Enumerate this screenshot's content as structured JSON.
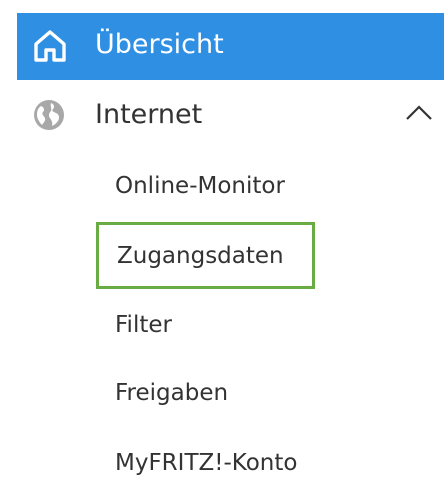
{
  "nav": {
    "home": {
      "label": "Übersicht",
      "icon": "home-icon",
      "active_color": "#2f8fe3"
    },
    "internet": {
      "label": "Internet",
      "icon": "globe-icon",
      "expanded": true,
      "children": [
        {
          "label": "Online-Monitor"
        },
        {
          "label": "Zugangsdaten",
          "selected": true,
          "highlight_color": "#6aac44"
        },
        {
          "label": "Filter"
        },
        {
          "label": "Freigaben"
        },
        {
          "label": "MyFRITZ!-Konto"
        }
      ]
    }
  }
}
